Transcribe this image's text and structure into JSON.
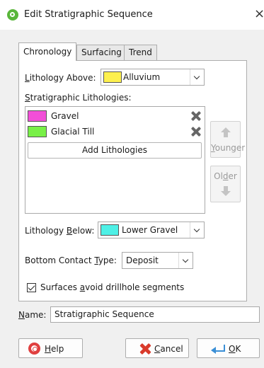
{
  "window": {
    "title": "Edit Stratigraphic Sequence",
    "close_glyph": "×",
    "app_icon": "leapfrog-app-icon"
  },
  "tabs": [
    {
      "label": "Chronology",
      "active": true
    },
    {
      "label": "Surfacing",
      "active": false
    },
    {
      "label": "Trend",
      "active": false
    }
  ],
  "chronology": {
    "lithology_above": {
      "label_key": "L",
      "label_rest": "ithology Above:",
      "value": "Alluvium",
      "color": "#fdf04e"
    },
    "strat_lithologies": {
      "label_key": "S",
      "label_rest": "tratigraphic Lithologies:",
      "items": [
        {
          "name": "Gravel",
          "color": "#f24fd8"
        },
        {
          "name": "Glacial Till",
          "color": "#78f047"
        }
      ],
      "add_button": "Add Lithologies"
    },
    "younger_button": {
      "key": "Y",
      "rest": "ounger"
    },
    "older_button": {
      "pre": "Ol",
      "key": "d",
      "post": "er"
    },
    "lithology_below": {
      "label_pre": "Lithology ",
      "label_key": "B",
      "label_post": "elow:",
      "value": "Lower Gravel",
      "color": "#4ef0e6"
    },
    "bottom_contact": {
      "label_pre": "Bottom Contact ",
      "label_key": "T",
      "label_post": "ype:",
      "value": "Deposit"
    },
    "avoid_drillholes": {
      "label_pre": "Surfaces ",
      "label_key": "a",
      "label_post": "void drillhole segments",
      "checked": true
    }
  },
  "name_field": {
    "label_key": "N",
    "label_rest": "ame:",
    "value": "Stratigraphic Sequence"
  },
  "buttons": {
    "help": {
      "key": "H",
      "rest": "elp"
    },
    "cancel": {
      "key": "C",
      "rest": "ancel"
    },
    "ok": {
      "key": "O",
      "rest": "K"
    }
  }
}
